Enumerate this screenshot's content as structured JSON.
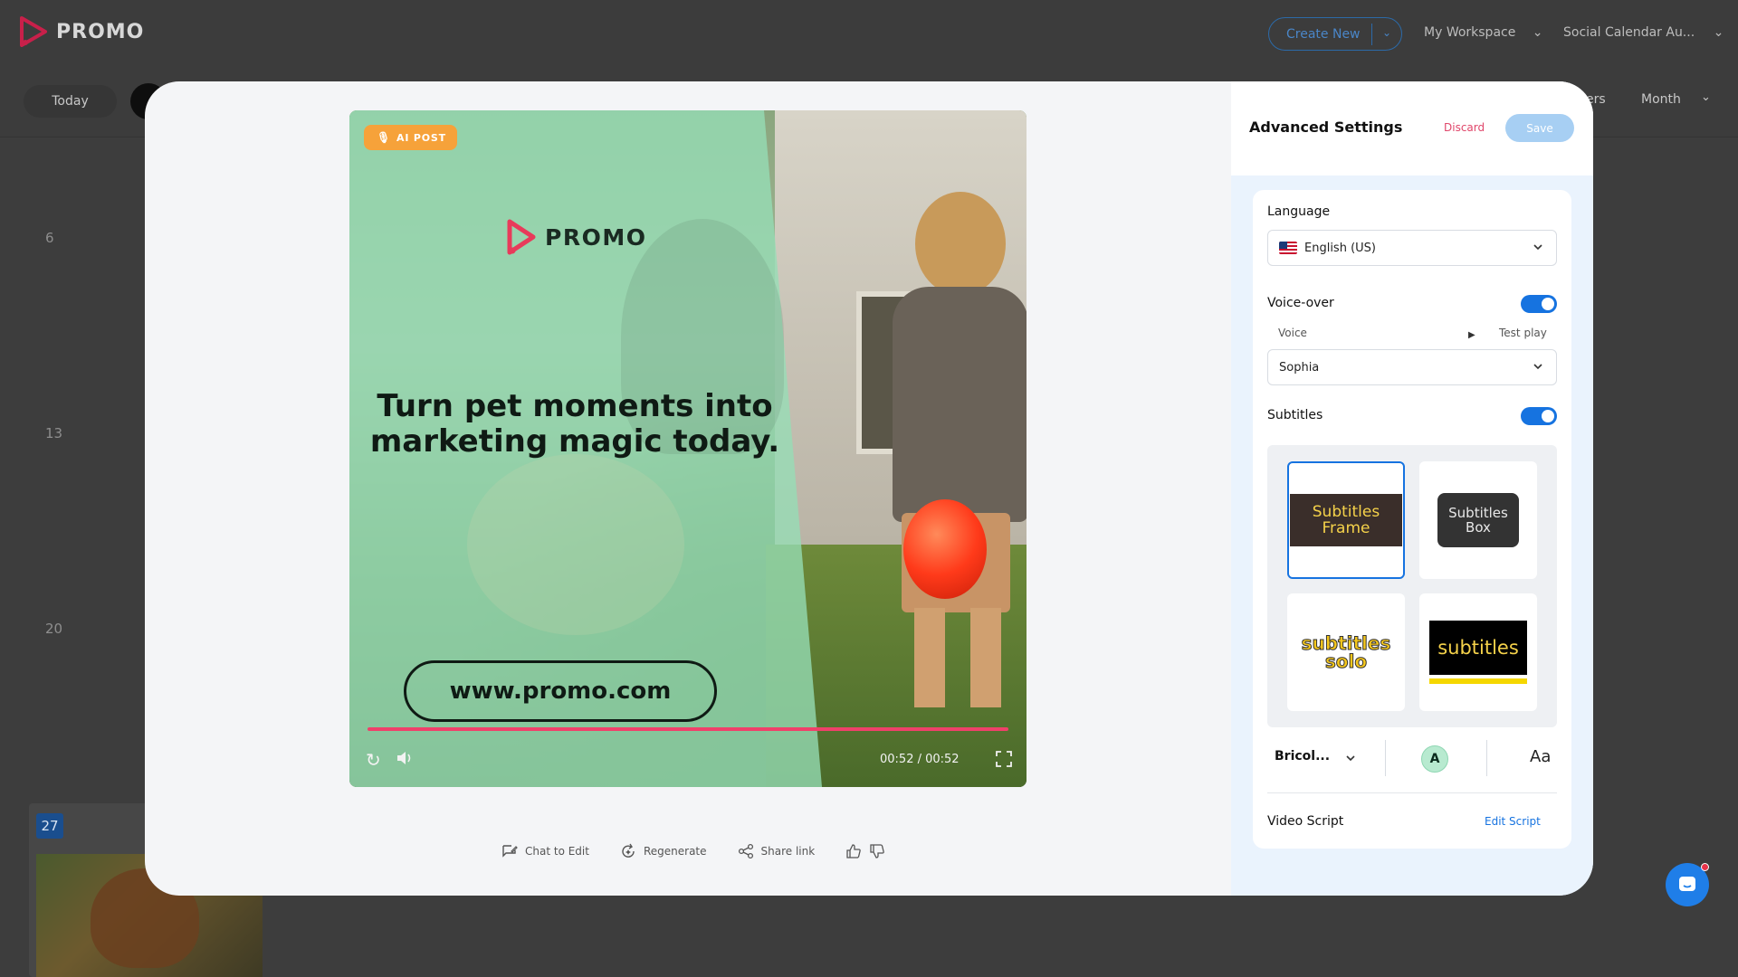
{
  "app": {
    "brand": "PROMO",
    "create_new": "Create New",
    "workspace": "My Workspace",
    "calendar_name": "Social Calendar Au...",
    "today": "Today",
    "filters_partial": "ers",
    "month": "Month",
    "day_numbers": [
      "6",
      "13",
      "20",
      "27"
    ]
  },
  "preview": {
    "badge": "AI POST",
    "logo_text": "PROMO",
    "headline": "Turn pet moments into marketing magic today.",
    "url": "www.promo.com",
    "time": "00:52 / 00:52",
    "progress": 1.0,
    "colors": {
      "overlay": "#96deb6",
      "progress": "#f0406a",
      "badge": "#f6a23a"
    }
  },
  "actions": {
    "chat": "Chat to Edit",
    "regenerate": "Regenerate",
    "share": "Share link"
  },
  "settings": {
    "title": "Advanced Settings",
    "discard": "Discard",
    "save": "Save",
    "language_label": "Language",
    "language_value": "English (US)",
    "voiceover_label": "Voice-over",
    "voiceover_on": true,
    "voice_label": "Voice",
    "test_play": "Test play",
    "voice_value": "Sophia",
    "subtitles_label": "Subtitles",
    "subtitles_on": true,
    "styles": {
      "frame": "Subtitles Frame",
      "box": "Subtitles Box",
      "solo": "subtitles solo",
      "yellow": "subtitles"
    },
    "selected_style": "frame",
    "font_name": "Bricol...",
    "color_letter": "A",
    "case_glyph": "Aa",
    "script_label": "Video Script",
    "edit_script": "Edit Script",
    "accent": "#1673e0"
  }
}
